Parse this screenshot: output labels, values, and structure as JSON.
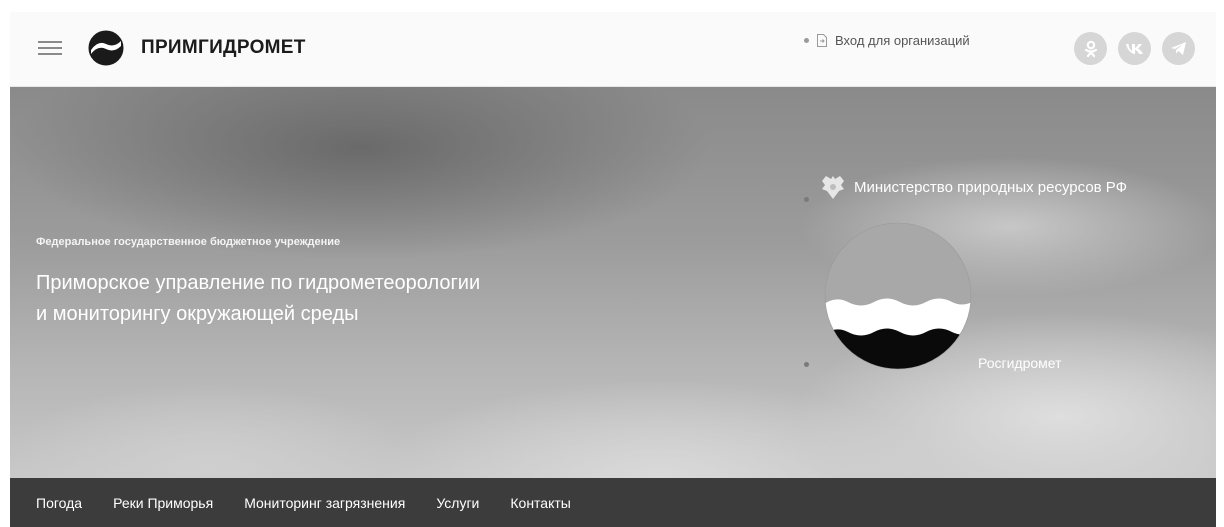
{
  "header": {
    "brand": "ПРИМГИДРОМЕТ",
    "org_login": "Вход для организаций",
    "social": [
      {
        "label": "ок",
        "icon": "odnoklassniki-icon"
      },
      {
        "label": "vk",
        "icon": "vk-icon"
      },
      {
        "label": "tg",
        "icon": "telegram-icon"
      }
    ]
  },
  "hero": {
    "subtitle": "Федеральное государственное бюджетное учреждение",
    "title_line1": "Приморское управление по гидрометеорологии",
    "title_line2": "и мониторингу окружающей среды",
    "ministry": "Министерство природных ресурсов РФ",
    "rosgidromet": "Росгидромет"
  },
  "nav": {
    "items": [
      "Погода",
      "Реки Приморья",
      "Мониторинг загрязнения",
      "Услуги",
      "Контакты"
    ]
  },
  "colors": {
    "nav_bg": "#3c3c3c",
    "header_bg": "#fafafa",
    "social_bg": "#d6d6d6"
  }
}
